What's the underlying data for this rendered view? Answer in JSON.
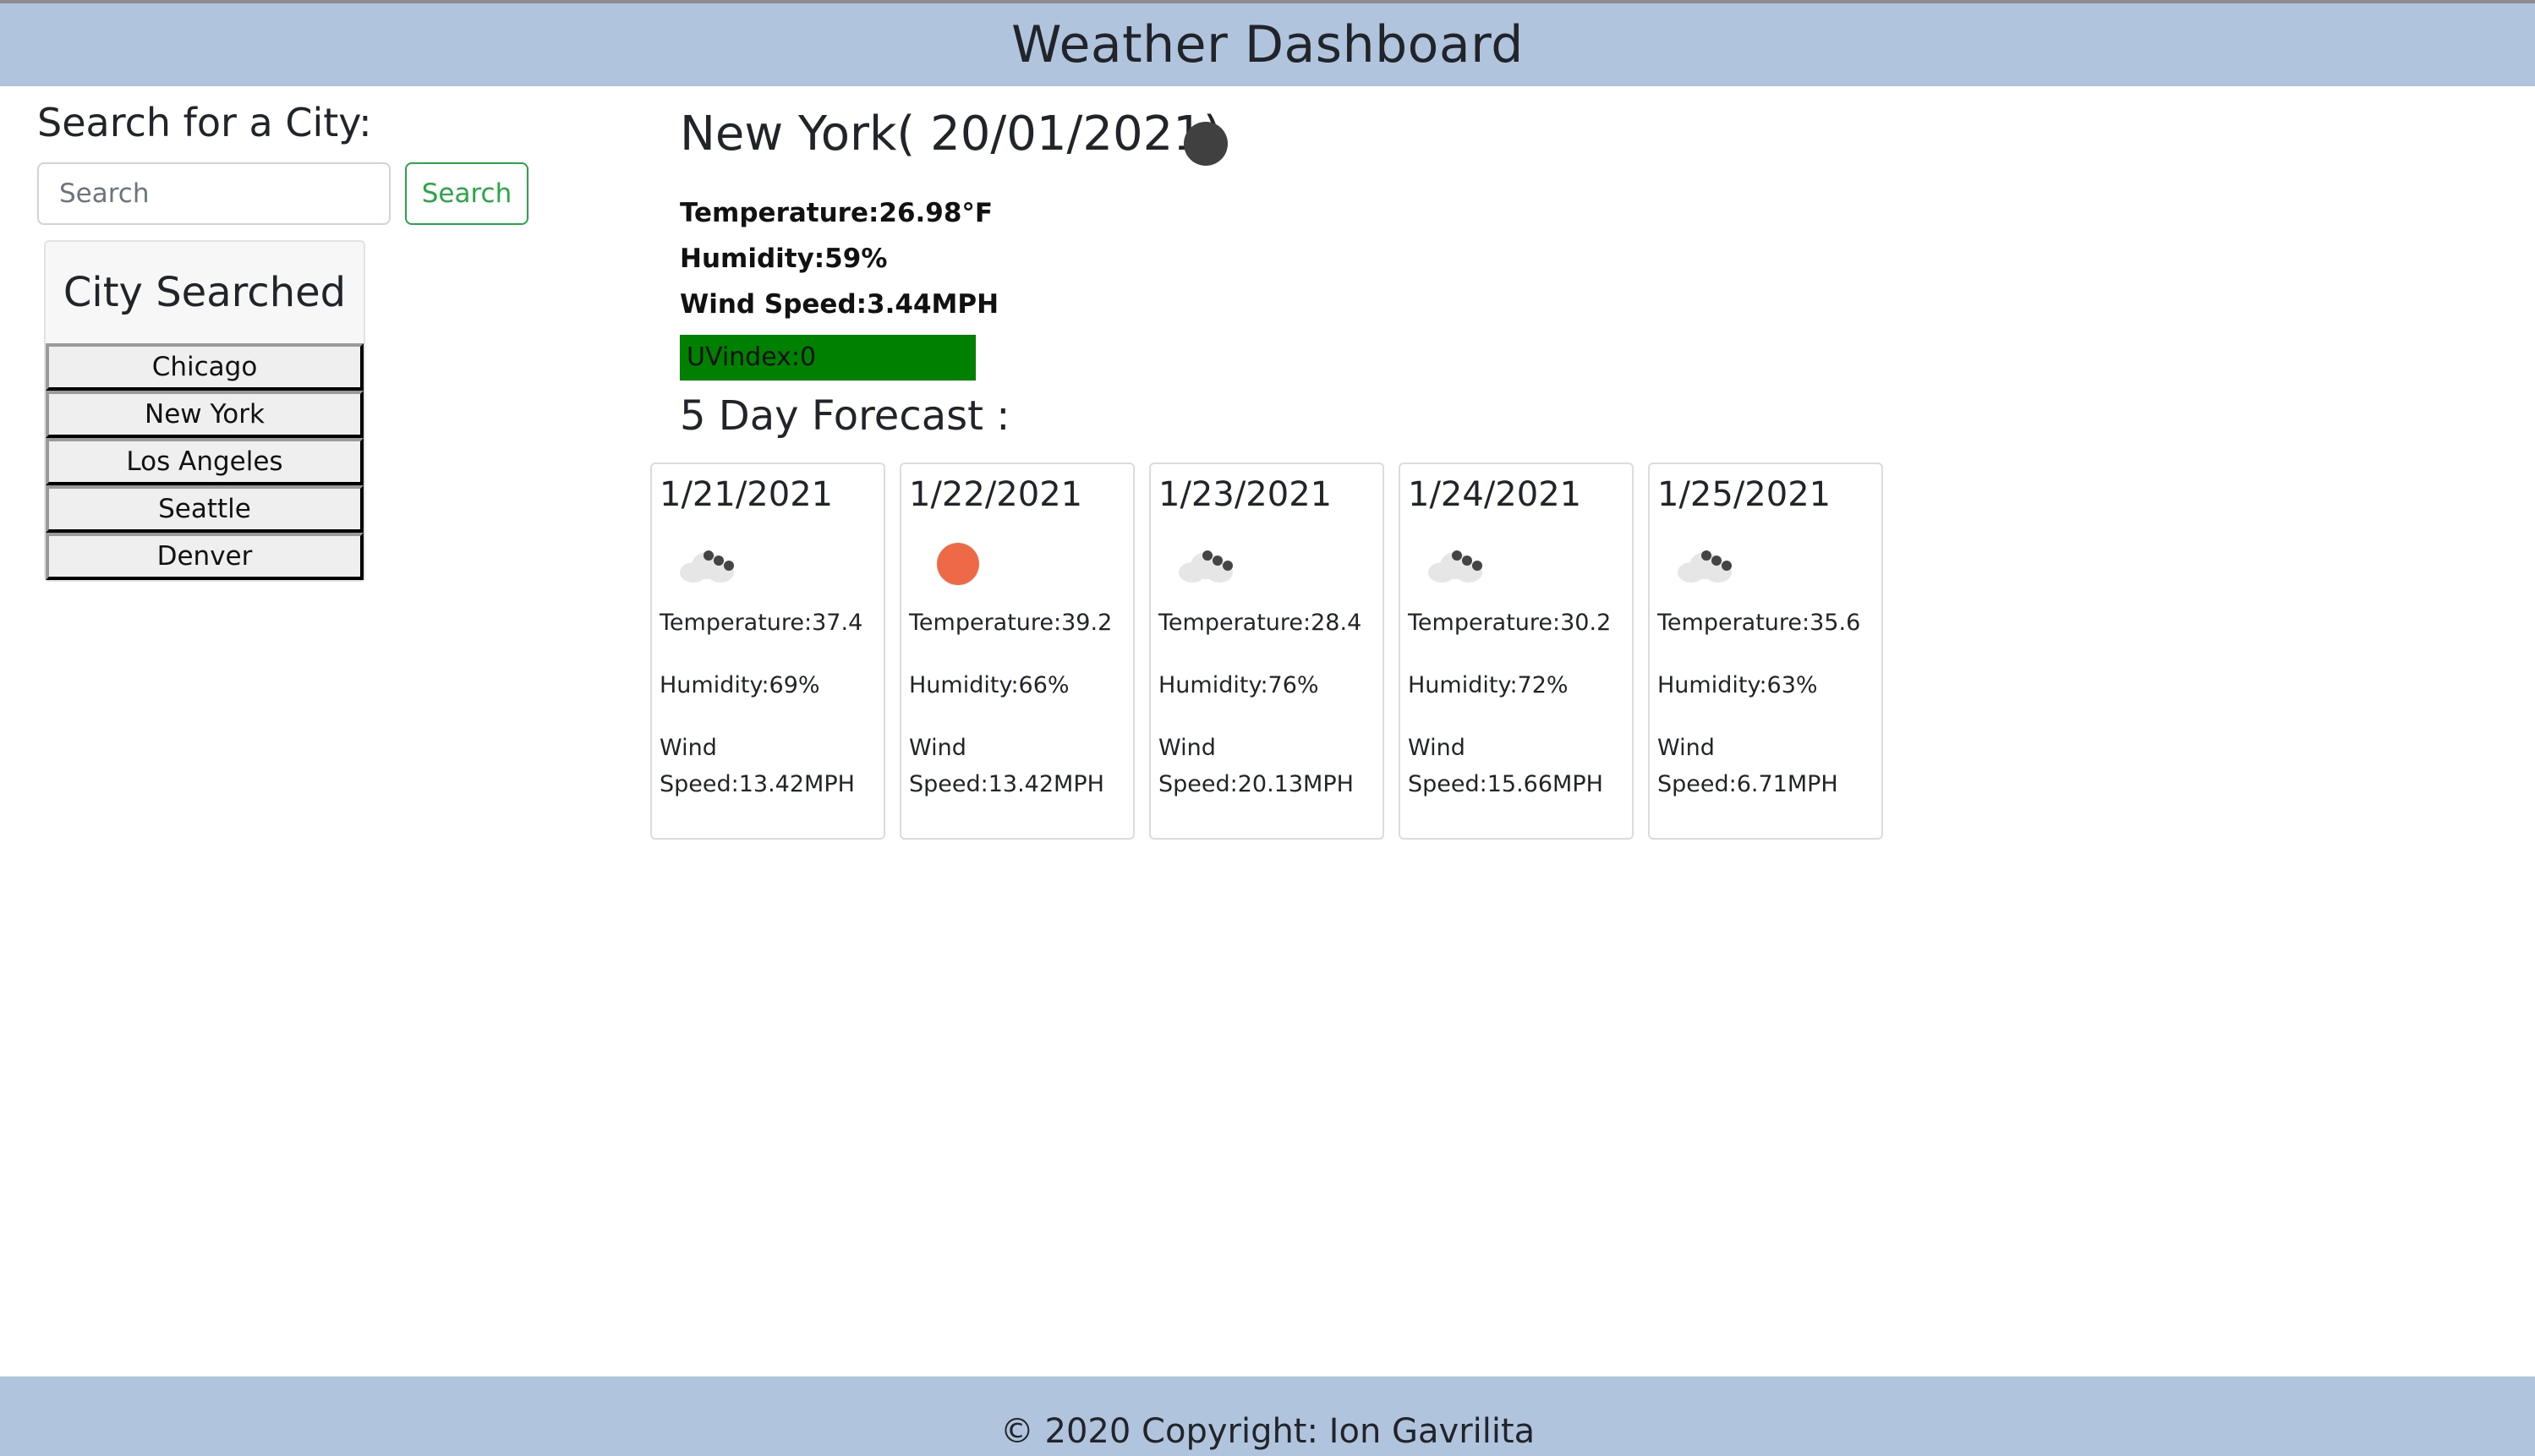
{
  "header": {
    "title": "Weather Dashboard"
  },
  "search": {
    "heading": "Search for a City:",
    "placeholder": "Search",
    "button_label": "Search"
  },
  "history": {
    "title": "City Searched",
    "cities": [
      "Chicago",
      "New York",
      "Los Angeles",
      "Seattle",
      "Denver"
    ]
  },
  "current": {
    "title": "New York( 20/01/2021)",
    "icon": "dark-circle-icon",
    "temperature": "Temperature:26.98°F",
    "humidity": "Humidity:59%",
    "wind": "Wind Speed:3.44MPH",
    "uv": "UVindex:0",
    "uv_color": "#008000"
  },
  "forecast": {
    "heading": "5 Day Forecast :",
    "days": [
      {
        "date": "1/21/2021",
        "icon": "cloud-snow-icon",
        "temp": "Temperature:37.4",
        "humidity": "Humidity:69%",
        "wind": "Wind Speed:13.42MPH"
      },
      {
        "date": "1/22/2021",
        "icon": "sun-icon",
        "temp": "Temperature:39.2",
        "humidity": "Humidity:66%",
        "wind": "Wind Speed:13.42MPH"
      },
      {
        "date": "1/23/2021",
        "icon": "cloud-snow-icon",
        "temp": "Temperature:28.4",
        "humidity": "Humidity:76%",
        "wind": "Wind Speed:20.13MPH"
      },
      {
        "date": "1/24/2021",
        "icon": "cloud-snow-icon",
        "temp": "Temperature:30.2",
        "humidity": "Humidity:72%",
        "wind": "Wind Speed:15.66MPH"
      },
      {
        "date": "1/25/2021",
        "icon": "cloud-snow-icon",
        "temp": "Temperature:35.6",
        "humidity": "Humidity:63%",
        "wind": "Wind Speed:6.71MPH"
      }
    ]
  },
  "footer": {
    "text": "© 2020 Copyright: Ion Gavrilita"
  },
  "colors": {
    "header_bg": "#b0c4de",
    "accent_green": "#28a745",
    "sun": "#ee6a47"
  }
}
